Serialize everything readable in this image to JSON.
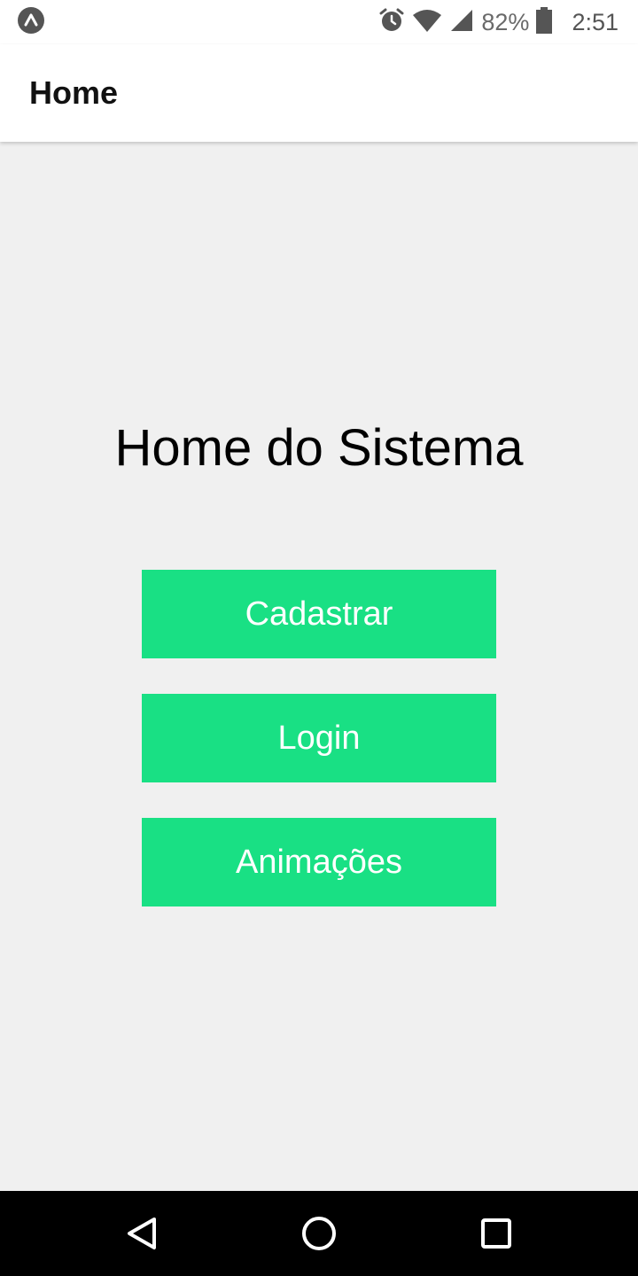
{
  "status_bar": {
    "app_icon": "expo-icon",
    "alarm_icon": "alarm-icon",
    "wifi_icon": "wifi-icon",
    "signal_icon": "signal-icon",
    "battery_percent": "82%",
    "battery_icon": "battery-icon",
    "time": "2:51"
  },
  "app_bar": {
    "title": "Home"
  },
  "main": {
    "heading": "Home do Sistema",
    "buttons": [
      {
        "label": "Cadastrar"
      },
      {
        "label": "Login"
      },
      {
        "label": "Animações"
      }
    ]
  },
  "nav_bar": {
    "back_icon": "back-triangle-icon",
    "home_icon": "home-circle-icon",
    "recents_icon": "recents-square-icon"
  },
  "colors": {
    "button": "#19e084",
    "background": "#f0f0f0",
    "app_bar": "#ffffff",
    "nav_bar": "#000000"
  }
}
